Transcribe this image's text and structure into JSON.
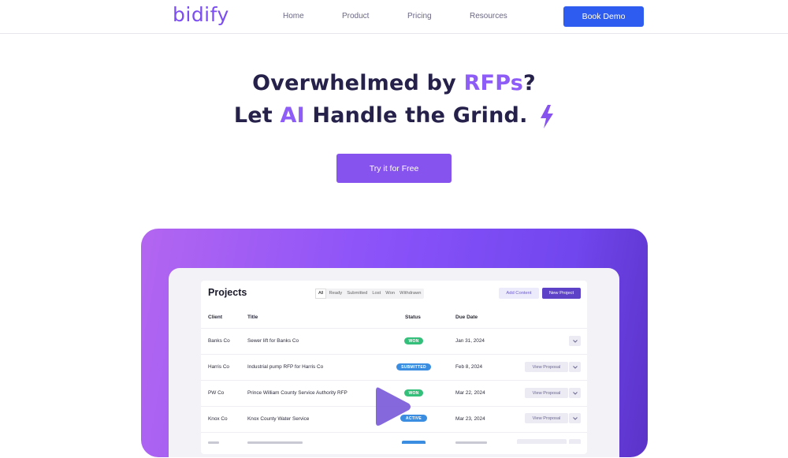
{
  "nav": {
    "logo": "bidify",
    "links": [
      "Home",
      "Product",
      "Pricing",
      "Resources"
    ],
    "cta": "Book Demo"
  },
  "hero": {
    "line1_a": "Overwhelmed by ",
    "line1_accent": "RFPs",
    "line1_b": "?",
    "line2_a": "Let ",
    "line2_accent": "AI",
    "line2_b": " Handle the Grind.",
    "cta": "Try it for Free"
  },
  "colors": {
    "brand": "#7b4df2",
    "accent_text": "#8e5cf7",
    "primary_button": "#2f5cf0",
    "cta_button": "#8753ef"
  },
  "app": {
    "title": "Projects",
    "filters": [
      "All",
      "Ready",
      "Submitted",
      "Lost",
      "Won",
      "Withdrawn"
    ],
    "add_content": "Add Content",
    "new_project": "New Project",
    "columns": [
      "Client",
      "Title",
      "Status",
      "Due Date"
    ],
    "rows": [
      {
        "client": "Banks Co",
        "title": "Sewer lift for Banks Co",
        "status": "WON",
        "due": "Jan 31, 2024",
        "action": ""
      },
      {
        "client": "Harris Co",
        "title": "Industrial pump RFP for Harris Co",
        "status": "SUBMITTED",
        "due": "Feb 8, 2024",
        "action": "View Proposal"
      },
      {
        "client": "PW Co",
        "title": "Prince William County Service Authority RFP",
        "status": "WON",
        "due": "Mar 22, 2024",
        "action": "View Proposal"
      },
      {
        "client": "Knox Co",
        "title": "Knox County Water Service",
        "status": "ACTIVE",
        "due": "Mar 23, 2024",
        "action": "View Proposal"
      }
    ]
  }
}
